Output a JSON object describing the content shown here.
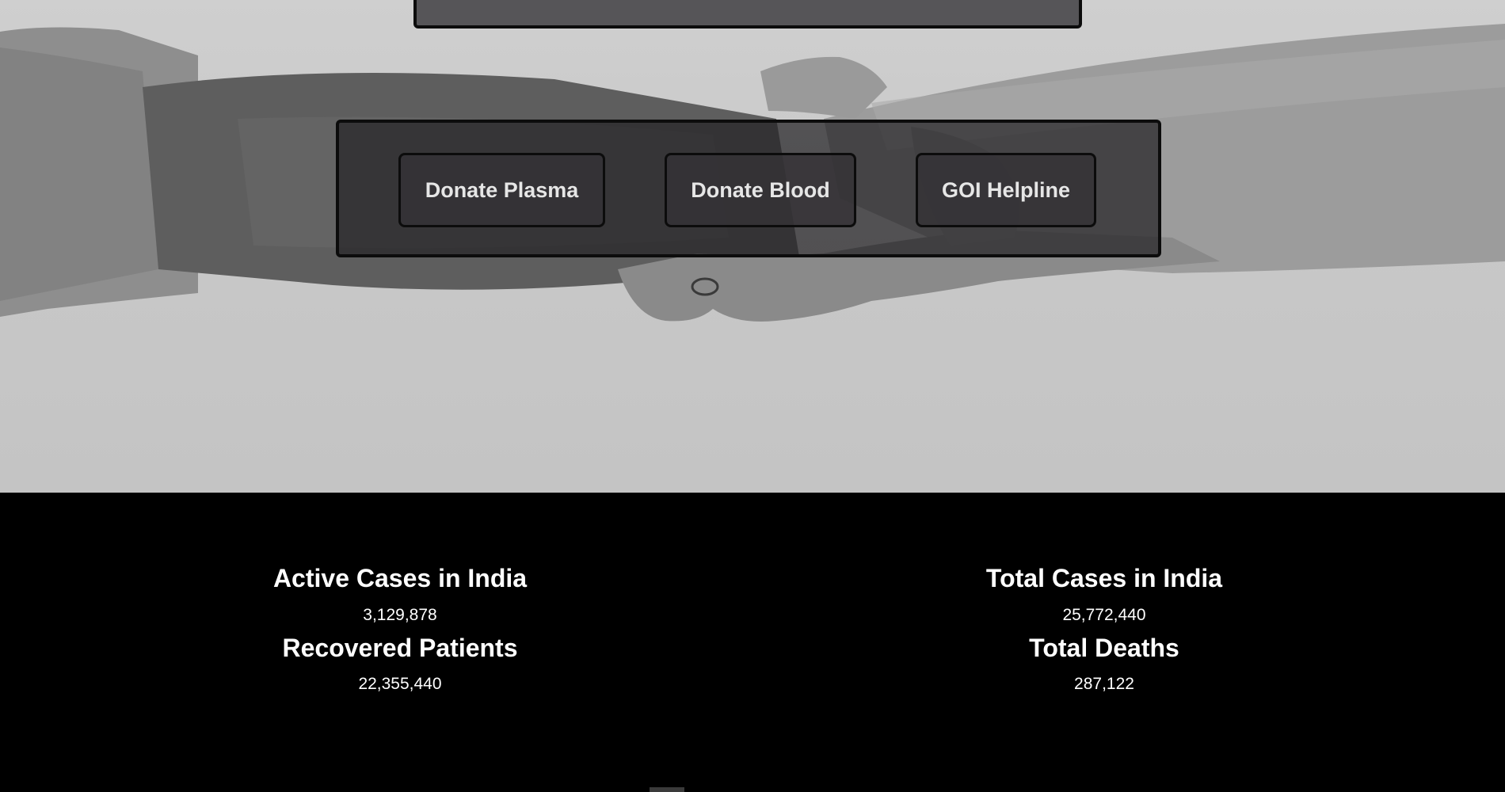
{
  "actions": {
    "donate_plasma": "Donate Plasma",
    "donate_blood": "Donate Blood",
    "goi_helpline": "GOI Helpline"
  },
  "stats": {
    "active_cases": {
      "label": "Active Cases in India",
      "value": "3,129,878"
    },
    "recovered": {
      "label": "Recovered Patients",
      "value": "22,355,440"
    },
    "total_cases": {
      "label": "Total Cases in India",
      "value": "25,772,440"
    },
    "total_deaths": {
      "label": "Total Deaths",
      "value": "287,122"
    }
  },
  "colors": {
    "hero_background": "#c8c8c8",
    "panel_fill": "#2a282b",
    "panel_border": "#0c0c0c",
    "button_text": "#e6e6e6",
    "stats_background": "#000000",
    "stats_text": "#ffffff"
  }
}
